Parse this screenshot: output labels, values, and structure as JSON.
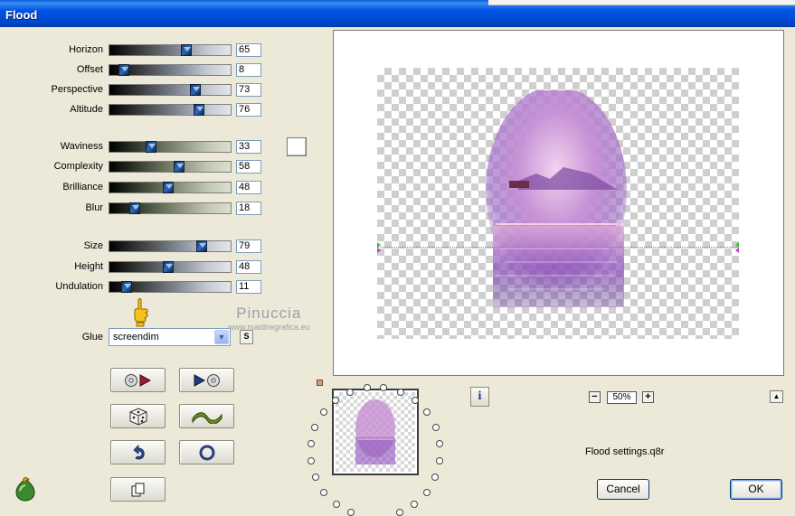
{
  "window": {
    "title": "Flood"
  },
  "params": [
    {
      "label": "Horizon",
      "value": "65",
      "fraction": 0.65
    },
    {
      "label": "Offset",
      "value": "8",
      "fraction": 0.08
    },
    {
      "label": "Perspective",
      "value": "73",
      "fraction": 0.73
    },
    {
      "label": "Altitude",
      "value": "76",
      "fraction": 0.76
    },
    {
      "label": "Waviness",
      "value": "33",
      "fraction": 0.33
    },
    {
      "label": "Complexity",
      "value": "58",
      "fraction": 0.58
    },
    {
      "label": "Brilliance",
      "value": "48",
      "fraction": 0.48
    },
    {
      "label": "Blur",
      "value": "18",
      "fraction": 0.18
    },
    {
      "label": "Size",
      "value": "79",
      "fraction": 0.79
    },
    {
      "label": "Height",
      "value": "48",
      "fraction": 0.48
    },
    {
      "label": "Undulation",
      "value": "11",
      "fraction": 0.11
    }
  ],
  "glue": {
    "label": "Glue",
    "selected": "screendim",
    "button": "S"
  },
  "watermark": {
    "line1": "Pinuccia",
    "line2": "www.maidiregrafica.eu"
  },
  "zoom": {
    "value": "50%"
  },
  "settings_file": "Flood settings.q8r",
  "buttons": {
    "cancel": "Cancel",
    "ok": "OK"
  },
  "colors": {
    "title_bar": "#0054e3",
    "dialog_bg": "#ece9d8",
    "slider_thumb": "#2f6ab5"
  }
}
